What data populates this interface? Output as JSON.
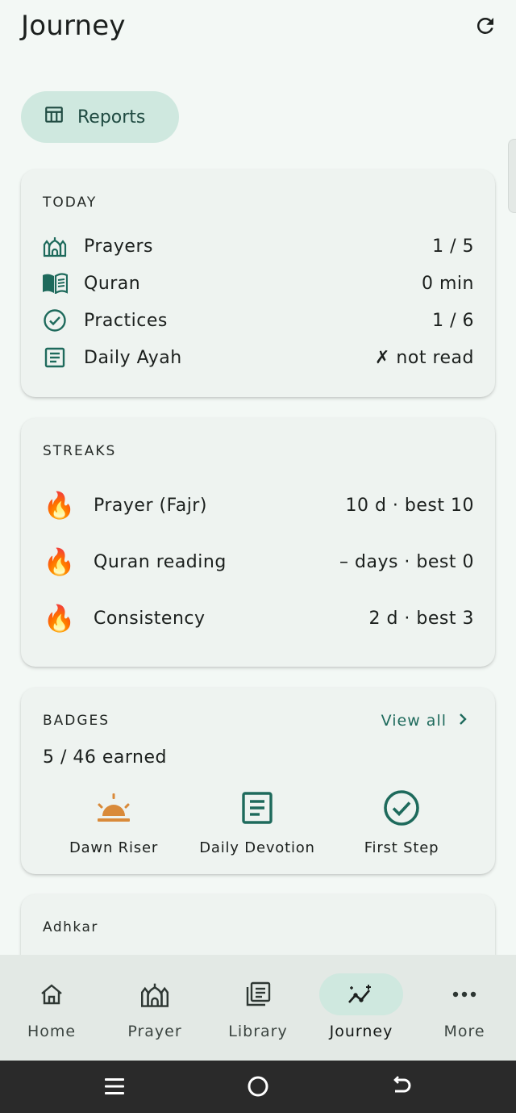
{
  "header": {
    "title": "Journey",
    "refresh_icon": "refresh-icon"
  },
  "reports": {
    "label": "Reports",
    "icon": "table-icon"
  },
  "today": {
    "title": "TODAY",
    "rows": [
      {
        "icon": "mosque-icon",
        "label": "Prayers",
        "value": "1 / 5"
      },
      {
        "icon": "book-icon",
        "label": "Quran",
        "value": "0 min"
      },
      {
        "icon": "check-circle-icon",
        "label": "Practices",
        "value": "1 / 6"
      },
      {
        "icon": "document-icon",
        "label": "Daily Ayah",
        "value": "✗ not read"
      }
    ]
  },
  "streaks": {
    "title": "STREAKS",
    "rows": [
      {
        "icon": "fire-icon",
        "label": "Prayer (Fajr)",
        "value": "10 d · best 10"
      },
      {
        "icon": "fire-icon",
        "label": "Quran reading",
        "value": "– days · best 0"
      },
      {
        "icon": "fire-icon",
        "label": "Consistency",
        "value": "2 d · best 3"
      }
    ]
  },
  "badges": {
    "title": "BADGES",
    "view_all": "View all",
    "earned": "5 / 46 earned",
    "items": [
      {
        "icon": "sunrise-icon",
        "name": "Dawn Riser"
      },
      {
        "icon": "document-icon",
        "name": "Daily Devotion"
      },
      {
        "icon": "check-circle-icon",
        "name": "First Step"
      }
    ]
  },
  "adhkar": {
    "title": "Adhkar"
  },
  "nav": {
    "items": [
      {
        "icon": "home-icon",
        "label": "Home"
      },
      {
        "icon": "mosque-icon",
        "label": "Prayer"
      },
      {
        "icon": "library-icon",
        "label": "Library"
      },
      {
        "icon": "journey-icon",
        "label": "Journey",
        "active": true
      },
      {
        "icon": "more-icon",
        "label": "More"
      }
    ]
  },
  "colors": {
    "accent": "#1e6a5c",
    "accent_container": "#cfe8df",
    "background": "#f3f8f5",
    "card": "#eef3f0",
    "badge_orange": "#d98a3a"
  }
}
